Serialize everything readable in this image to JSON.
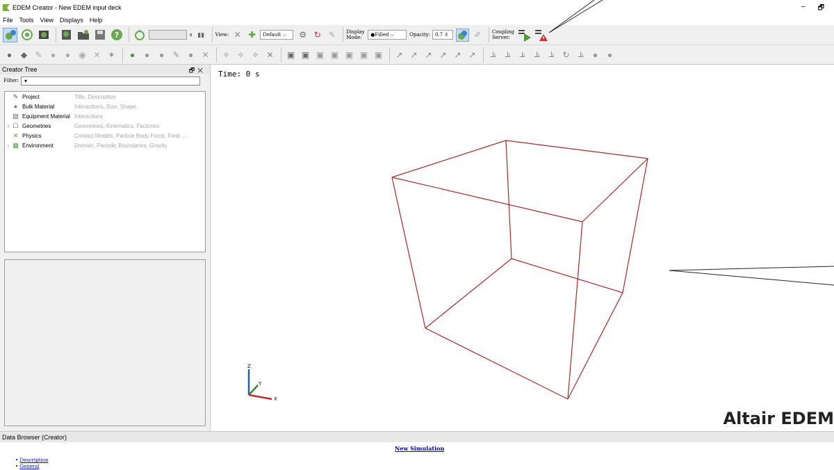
{
  "window": {
    "title": "EDEM Creator - New EDEM input deck",
    "minimize_label": "–",
    "restore_label": "🗗"
  },
  "menu": [
    "File",
    "Tools",
    "View",
    "Displays",
    "Help"
  ],
  "toolbar": {
    "time_unit": "s",
    "view_label": "View:",
    "view_preset": "Default",
    "display_mode_label": "Display Mode:",
    "display_mode": "Filled",
    "opacity_label": "Opacity:",
    "opacity_value": "0.7",
    "coupling_label": "Coupling Server:"
  },
  "creator_tree": {
    "header": "Creator Tree",
    "filter_label": "Filter:",
    "filter_value": "▾",
    "items": [
      {
        "name": "Project",
        "desc": "Title, Description",
        "expandable": false,
        "icon": "pencil-icon"
      },
      {
        "name": "Bulk Material",
        "desc": "Interactions, Size, Shape",
        "expandable": false,
        "icon": "sphere-icon"
      },
      {
        "name": "Equipment Material",
        "desc": "Interactions",
        "expandable": false,
        "icon": "hatched-box-icon"
      },
      {
        "name": "Geometries",
        "desc": "Geometries, Kinematics, Factories",
        "expandable": true,
        "icon": "box-icon"
      },
      {
        "name": "Physics",
        "desc": "Contact Models, Particle Body Force, Field ...",
        "expandable": false,
        "icon": "cross-arrows-icon"
      },
      {
        "name": "Environment",
        "desc": "Domain, Periodic Boundaries, Gravity",
        "expandable": true,
        "icon": "grid-box-icon"
      }
    ]
  },
  "viewport": {
    "time": "Time: 0 s",
    "watermark": "Altair EDEM",
    "axis_x": "X",
    "axis_y": "Y",
    "axis_z": "Z",
    "box_color": "#a52a2a"
  },
  "data_browser": {
    "header": "Data Browser (Creator)",
    "title": "New Simulation",
    "links": [
      "Description",
      "General"
    ]
  }
}
